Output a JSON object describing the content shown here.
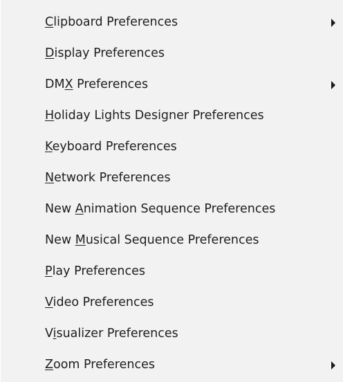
{
  "menu": {
    "items": [
      {
        "id": "clipboard",
        "before": "",
        "mnemonic": "C",
        "after": "lipboard Preferences",
        "submenu": true
      },
      {
        "id": "display",
        "before": "",
        "mnemonic": "D",
        "after": "isplay Preferences",
        "submenu": false
      },
      {
        "id": "dmx",
        "before": "DM",
        "mnemonic": "X",
        "after": " Preferences",
        "submenu": true
      },
      {
        "id": "holiday-lights-designer",
        "before": "",
        "mnemonic": "H",
        "after": "oliday Lights Designer Preferences",
        "submenu": false
      },
      {
        "id": "keyboard",
        "before": "",
        "mnemonic": "K",
        "after": "eyboard Preferences",
        "submenu": false
      },
      {
        "id": "network",
        "before": "",
        "mnemonic": "N",
        "after": "etwork Preferences",
        "submenu": false
      },
      {
        "id": "new-animation-sequence",
        "before": "New ",
        "mnemonic": "A",
        "after": "nimation Sequence Preferences",
        "submenu": false
      },
      {
        "id": "new-musical-sequence",
        "before": "New ",
        "mnemonic": "M",
        "after": "usical Sequence Preferences",
        "submenu": false
      },
      {
        "id": "play",
        "before": "",
        "mnemonic": "P",
        "after": "lay Preferences",
        "submenu": false
      },
      {
        "id": "video",
        "before": "",
        "mnemonic": "V",
        "after": "ideo Preferences",
        "submenu": false
      },
      {
        "id": "visualizer",
        "before": "V",
        "mnemonic": "i",
        "after": "sualizer Preferences",
        "submenu": false
      },
      {
        "id": "zoom",
        "before": "",
        "mnemonic": "Z",
        "after": "oom Preferences",
        "submenu": true
      }
    ],
    "submenu_arrow_icon": "triangle-right-icon"
  }
}
